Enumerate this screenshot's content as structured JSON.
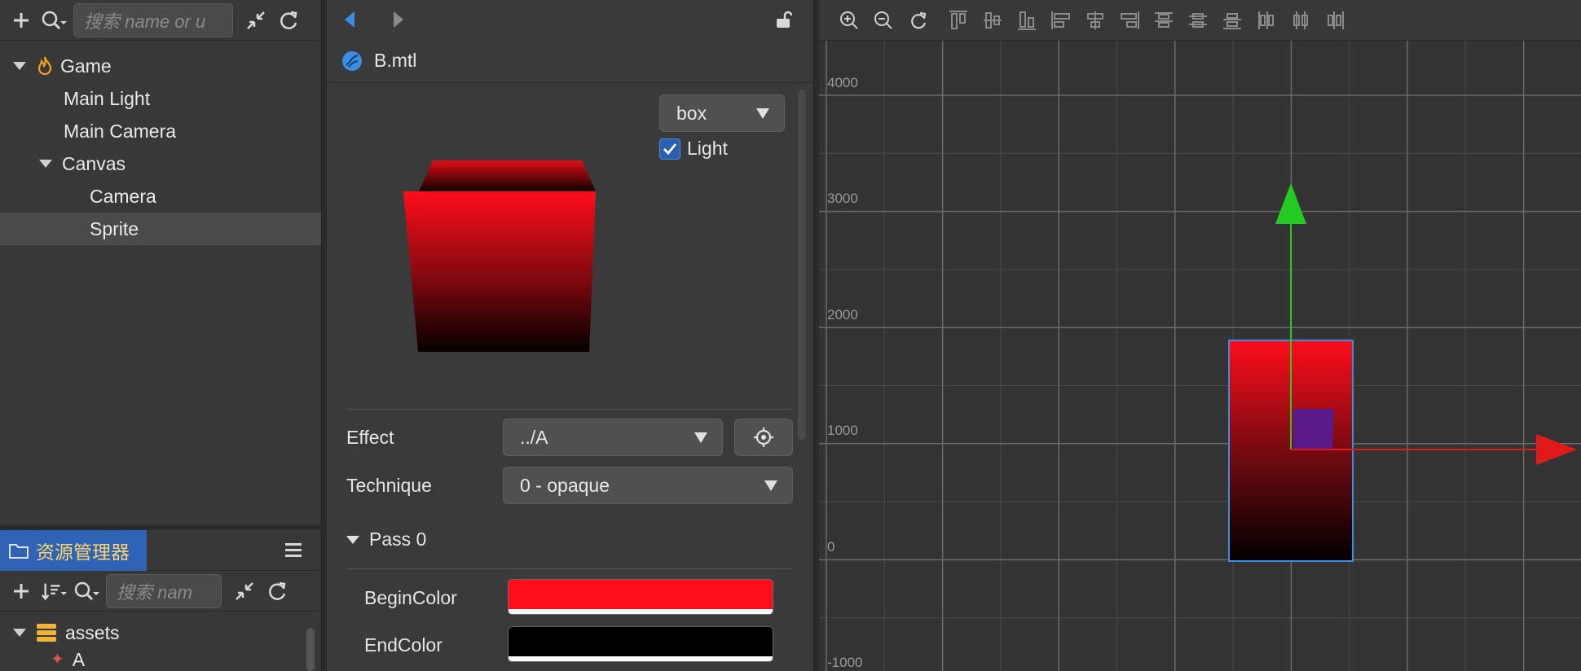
{
  "hierarchy": {
    "search_placeholder": "搜索 name or u",
    "tree": [
      {
        "label": "Game"
      },
      {
        "label": "Main Light"
      },
      {
        "label": "Main Camera"
      },
      {
        "label": "Canvas"
      },
      {
        "label": "Camera"
      },
      {
        "label": "Sprite"
      }
    ]
  },
  "assets": {
    "tab_label": "资源管理器",
    "search_placeholder": "搜索 nam",
    "tree": [
      {
        "label": "assets"
      },
      {
        "label": "A"
      }
    ]
  },
  "inspector": {
    "file_name": "B.mtl",
    "preview": {
      "mesh_value": "box",
      "light_label": "Light",
      "light_checked": true
    },
    "effect": {
      "label": "Effect",
      "value": "../A"
    },
    "technique": {
      "label": "Technique",
      "value": "0 - opaque"
    },
    "pass": {
      "label": "Pass 0"
    },
    "begin_color": {
      "label": "BeginColor",
      "color": "#ff0d1a"
    },
    "end_color": {
      "label": "EndColor",
      "color": "#000000"
    }
  },
  "scene": {
    "ruler_labels": [
      "4000",
      "3000",
      "2000",
      "1000",
      "0",
      "-1000"
    ]
  }
}
